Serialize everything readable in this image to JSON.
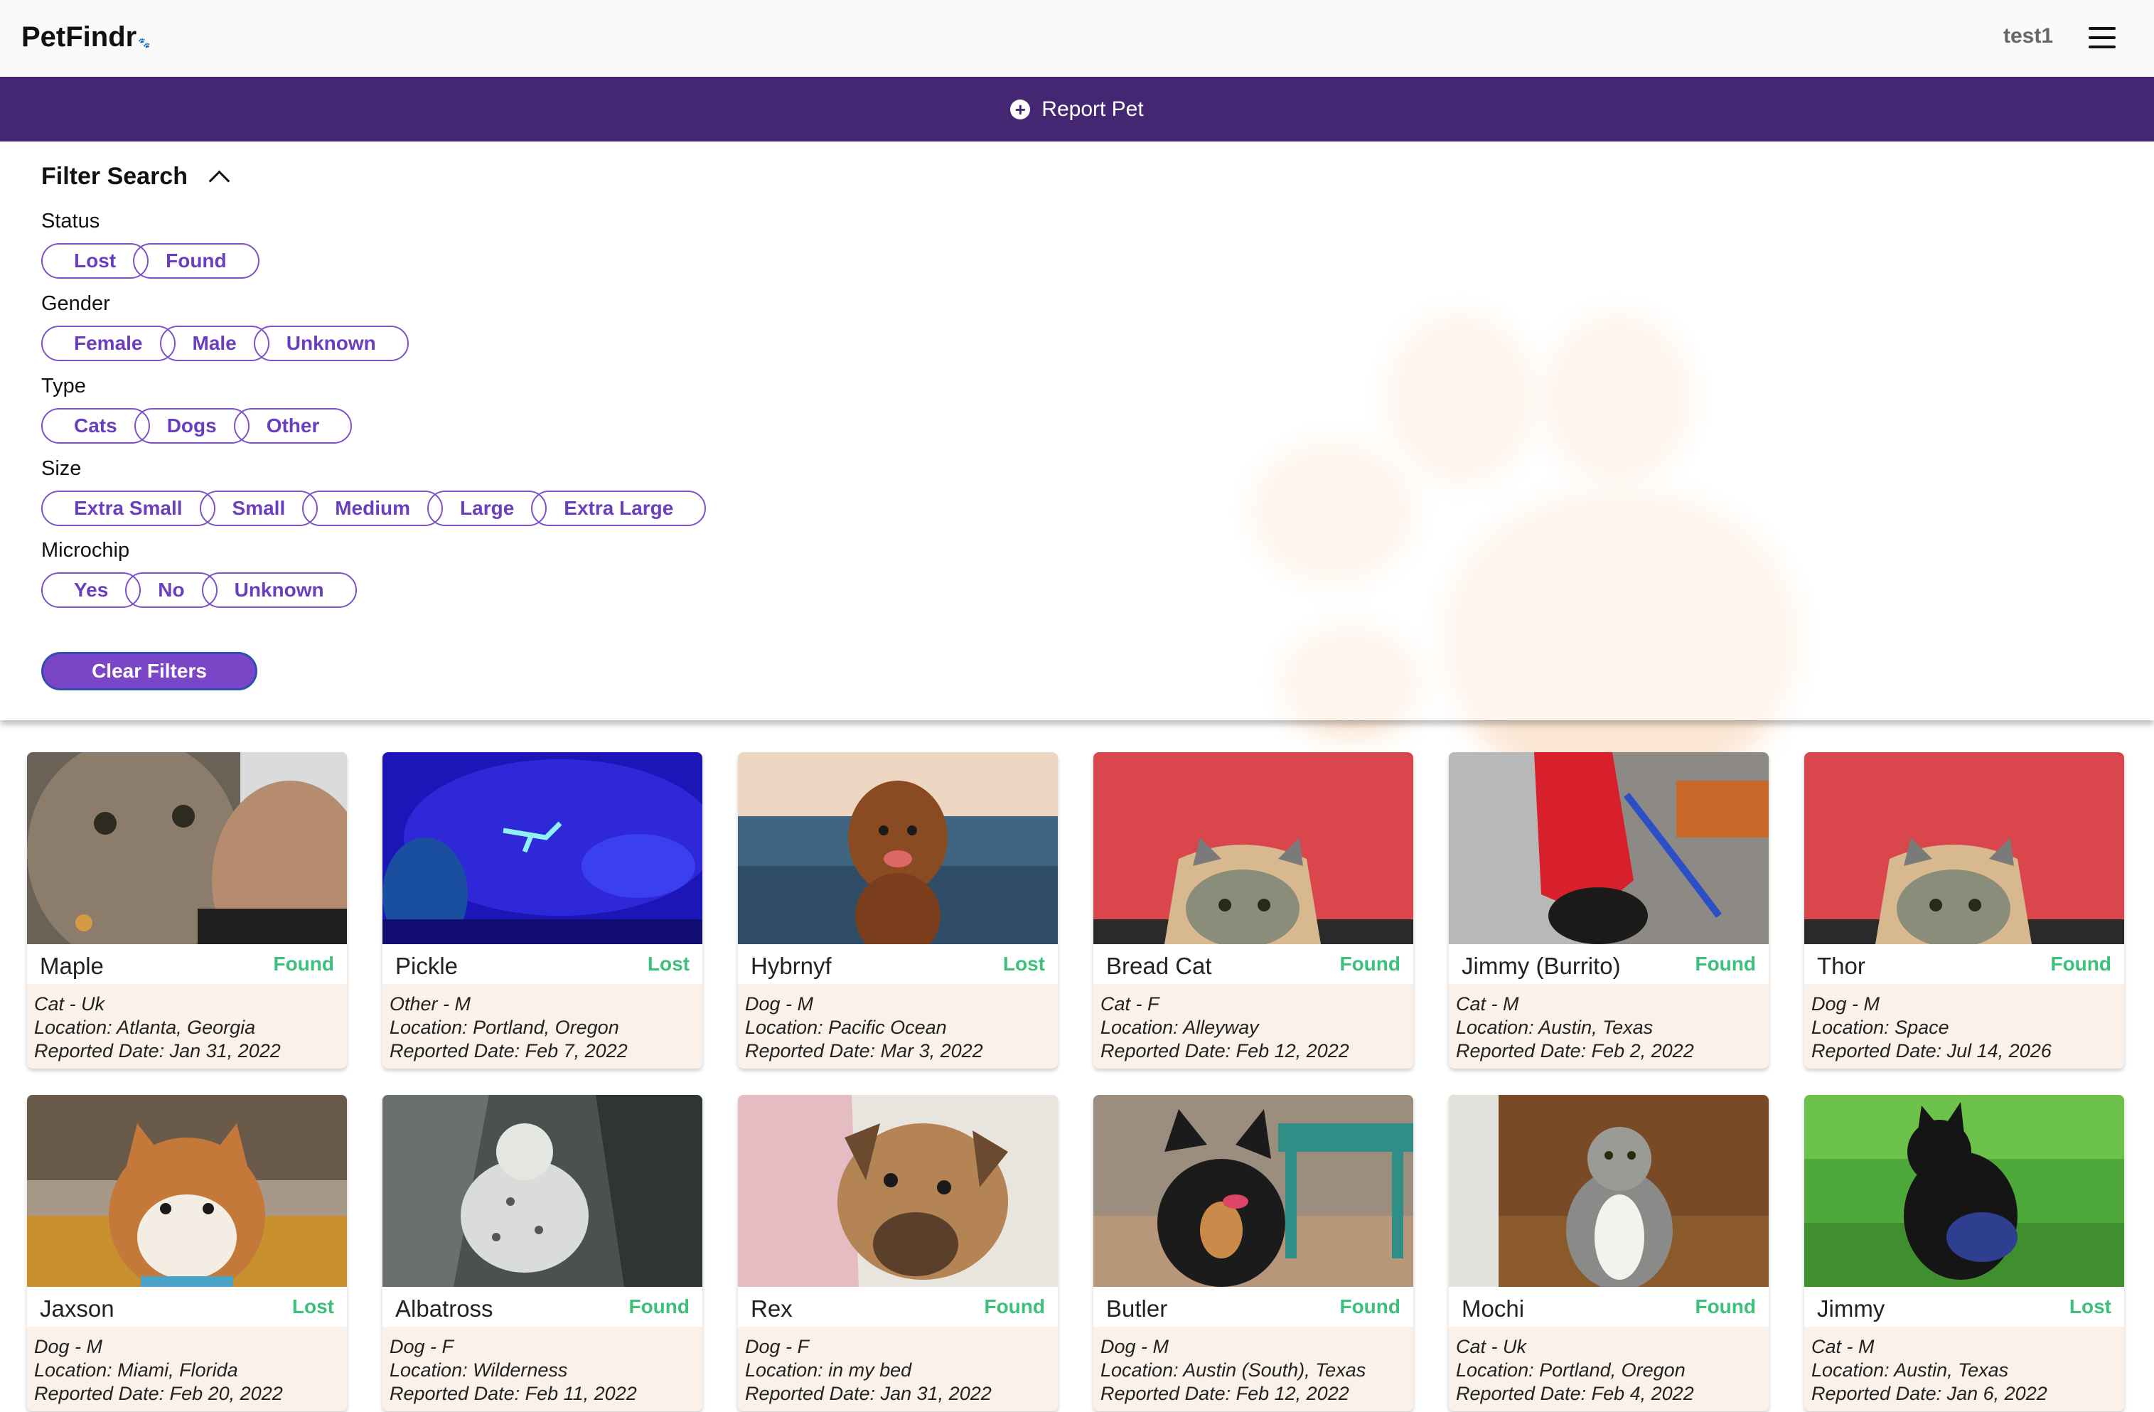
{
  "header": {
    "logo": "PetFindr",
    "user": "test1"
  },
  "report_button": {
    "label": "Report Pet"
  },
  "filter": {
    "title": "Filter Search",
    "groups": [
      {
        "label": "Status",
        "options": [
          "Lost",
          "Found"
        ]
      },
      {
        "label": "Gender",
        "options": [
          "Female",
          "Male",
          "Unknown"
        ]
      },
      {
        "label": "Type",
        "options": [
          "Cats",
          "Dogs",
          "Other"
        ]
      },
      {
        "label": "Size",
        "options": [
          "Extra Small",
          "Small",
          "Medium",
          "Large",
          "Extra Large"
        ]
      },
      {
        "label": "Microchip",
        "options": [
          "Yes",
          "No",
          "Unknown"
        ]
      }
    ],
    "clear_label": "Clear Filters"
  },
  "colors": {
    "primary": "#452673",
    "accent": "#6a3fbf",
    "found": "#3cc07a",
    "card_bg": "#fbf1e8"
  },
  "pets": [
    {
      "name": "Maple",
      "status": "Found",
      "info": "Cat - Uk",
      "location": "Location: Atlanta, Georgia",
      "date": "Reported Date: Jan 31, 2022"
    },
    {
      "name": "Pickle",
      "status": "Lost",
      "info": "Other - M",
      "location": "Location: Portland, Oregon",
      "date": "Reported Date: Feb 7, 2022"
    },
    {
      "name": "Hybrnyf",
      "status": "Lost",
      "info": "Dog - M",
      "location": "Location: Pacific Ocean",
      "date": "Reported Date: Mar 3, 2022"
    },
    {
      "name": "Bread Cat",
      "status": "Found",
      "info": "Cat - F",
      "location": "Location: Alleyway",
      "date": "Reported Date: Feb 12, 2022"
    },
    {
      "name": "Jimmy (Burrito)",
      "status": "Found",
      "info": "Cat - M",
      "location": "Location: Austin, Texas",
      "date": "Reported Date: Feb 2, 2022"
    },
    {
      "name": "Thor",
      "status": "Found",
      "info": "Dog - M",
      "location": "Location: Space",
      "date": "Reported Date: Jul 14, 2026"
    },
    {
      "name": "Jaxson",
      "status": "Lost",
      "info": "Dog - M",
      "location": "Location: Miami, Florida",
      "date": "Reported Date: Feb 20, 2022"
    },
    {
      "name": "Albatross",
      "status": "Found",
      "info": "Dog - F",
      "location": "Location: Wilderness",
      "date": "Reported Date: Feb 11, 2022"
    },
    {
      "name": "Rex",
      "status": "Found",
      "info": "Dog - F",
      "location": "Location: in my bed",
      "date": "Reported Date: Jan 31, 2022"
    },
    {
      "name": "Butler",
      "status": "Found",
      "info": "Dog - M",
      "location": "Location: Austin (South), Texas",
      "date": "Reported Date: Feb 12, 2022"
    },
    {
      "name": "Mochi",
      "status": "Found",
      "info": "Cat - Uk",
      "location": "Location: Portland, Oregon",
      "date": "Reported Date: Feb 4, 2022"
    },
    {
      "name": "Jimmy",
      "status": "Lost",
      "info": "Cat - M",
      "location": "Location: Austin, Texas",
      "date": "Reported Date: Jan 6, 2022"
    }
  ]
}
